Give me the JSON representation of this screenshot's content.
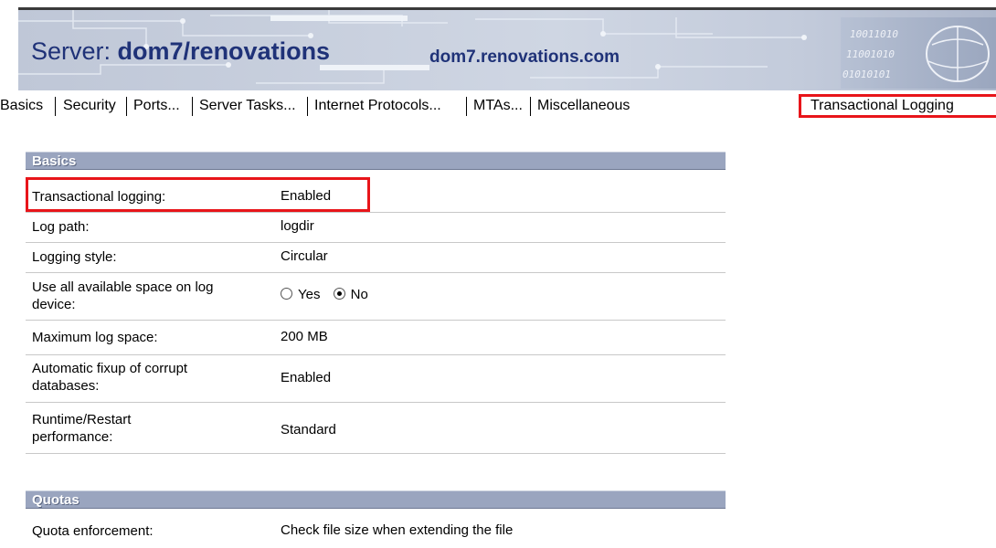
{
  "server": {
    "title_prefix": "Server: ",
    "name": "dom7/renovations",
    "domain": "dom7.renovations.com"
  },
  "tabs": [
    {
      "label": "Basics"
    },
    {
      "label": "Security"
    },
    {
      "label": "Ports..."
    },
    {
      "label": "Server Tasks..."
    },
    {
      "label": "Internet Protocols..."
    },
    {
      "label": "MTAs..."
    },
    {
      "label": "Miscellaneous"
    },
    {
      "label": "Transactional Logging",
      "active": true
    }
  ],
  "sections": {
    "basics": {
      "title": "Basics",
      "rows": {
        "transactional_logging": {
          "label": "Transactional logging:",
          "value": "Enabled"
        },
        "log_path": {
          "label": "Log path:",
          "value": "logdir"
        },
        "logging_style": {
          "label": "Logging style:",
          "value": "Circular"
        },
        "use_all_space": {
          "label": "Use all available space on log device:",
          "option_yes": "Yes",
          "option_no": "No",
          "selected": "No"
        },
        "max_log_space": {
          "label": "Maximum log space:",
          "value": "200 MB"
        },
        "auto_fixup": {
          "label": "Automatic fixup of corrupt databases:",
          "value": "Enabled"
        },
        "runtime_restart": {
          "label": "Runtime/Restart performance:",
          "value": "Standard"
        }
      }
    },
    "quotas": {
      "title": "Quotas",
      "rows": {
        "quota_enforcement": {
          "label": "Quota enforcement:",
          "value": "Check file size when extending the file"
        }
      }
    }
  },
  "colors": {
    "title_blue": "#1f3278",
    "highlight_red": "#e8151a",
    "section_header": "#9aa5bf"
  }
}
